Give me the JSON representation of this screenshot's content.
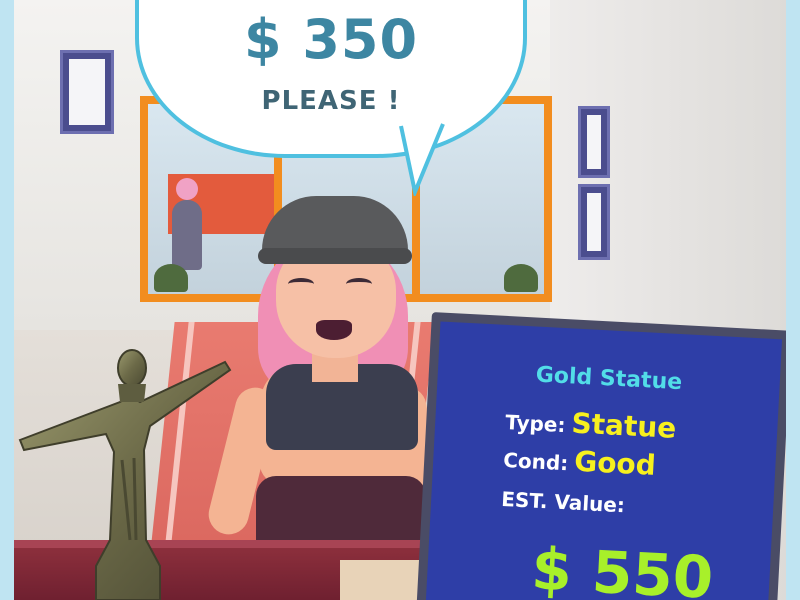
{
  "customer_offer": {
    "price": "$ 350",
    "message": "PLEASE !"
  },
  "item_card": {
    "name": "Gold Statue",
    "type_label": "Type:",
    "type_value": "Statue",
    "condition_label": "Cond:",
    "condition_value": "Good",
    "estimate_label": "EST. Value:",
    "estimate_value": "$ 550"
  },
  "colors": {
    "bubble_border": "#4fc0e0",
    "price_text": "#3d86a2",
    "board_background": "#2e3ea7",
    "item_name": "#52dde8",
    "item_values": "#f7f01e",
    "estimate_value": "#a8f02a"
  }
}
